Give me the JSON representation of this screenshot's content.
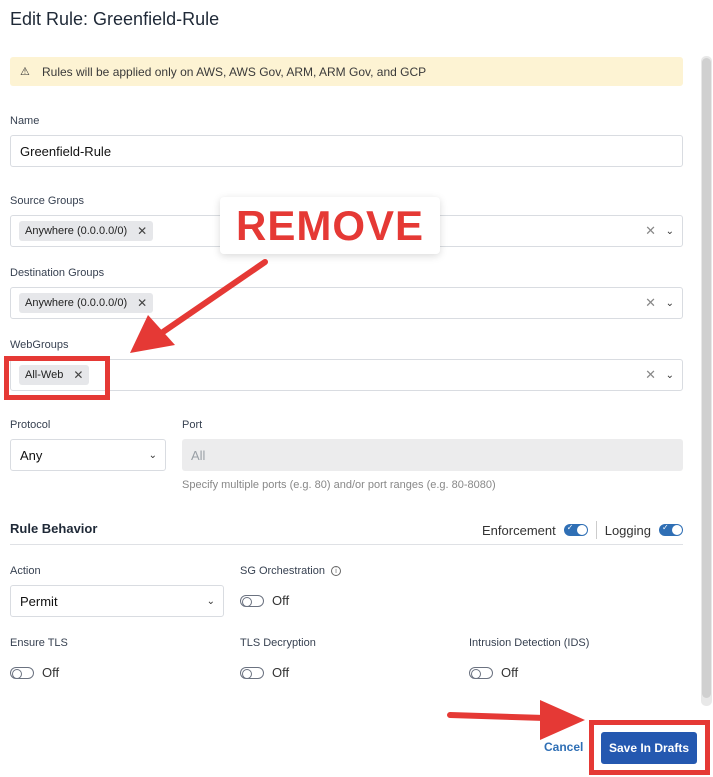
{
  "title": "Edit Rule: Greenfield-Rule",
  "warning": {
    "icon": "warning-icon",
    "text": "Rules will be applied only on AWS, AWS Gov, ARM, ARM Gov, and GCP"
  },
  "name": {
    "label": "Name",
    "value": "Greenfield-Rule"
  },
  "source_groups": {
    "label": "Source Groups",
    "chips": [
      "Anywhere (0.0.0.0/0)"
    ]
  },
  "destination_groups": {
    "label": "Destination Groups",
    "chips": [
      "Anywhere (0.0.0.0/0)"
    ]
  },
  "webgroups": {
    "label": "WebGroups",
    "chips": [
      "All-Web"
    ]
  },
  "protocol": {
    "label": "Protocol",
    "value": "Any"
  },
  "port": {
    "label": "Port",
    "placeholder": "All",
    "hint": "Specify multiple ports (e.g. 80) and/or port ranges (e.g. 80-8080)"
  },
  "rule_behavior": {
    "title": "Rule Behavior",
    "enforcement_label": "Enforcement",
    "logging_label": "Logging",
    "action": {
      "label": "Action",
      "value": "Permit"
    },
    "sg_orchestration": {
      "label": "SG Orchestration",
      "state": "Off"
    },
    "ensure_tls": {
      "label": "Ensure TLS",
      "state": "Off"
    },
    "tls_decryption": {
      "label": "TLS Decryption",
      "state": "Off"
    },
    "ids": {
      "label": "Intrusion Detection (IDS)",
      "state": "Off"
    }
  },
  "footer": {
    "cancel_label": "Cancel",
    "save_label": "Save In Drafts"
  },
  "annotation": {
    "remove_label": "REMOVE",
    "color": "#e53935"
  }
}
